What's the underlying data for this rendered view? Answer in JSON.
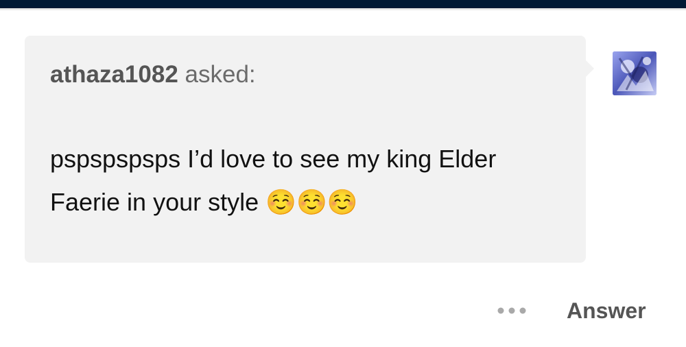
{
  "ask": {
    "asker_name": "athaza1082",
    "asked_label": "asked:",
    "question": "pspspspsps I’d love to see my king Elder Faerie in your style ☺️☺️☺️"
  },
  "footer": {
    "more_icon": "ellipsis-icon",
    "answer_label": "Answer"
  },
  "colors": {
    "top_bar": "#001935",
    "bubble": "#f2f2f2",
    "text": "#111111",
    "muted": "#555555"
  }
}
